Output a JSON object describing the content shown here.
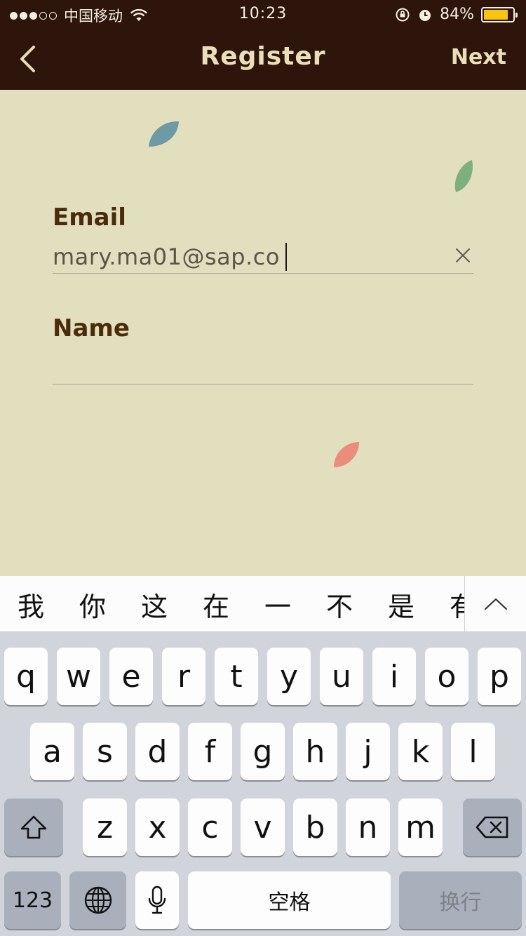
{
  "status_bar": {
    "carrier": "中国移动",
    "time": "10:23",
    "battery_percent": "84%",
    "battery_level": 0.84,
    "signal_bars_filled": 3,
    "signal_bars_total": 5
  },
  "nav": {
    "title": "Register",
    "next_label": "Next"
  },
  "form": {
    "email_label": "Email",
    "email_value": "mary.ma01@sap.co",
    "name_label": "Name",
    "name_value": ""
  },
  "leaf_colors": [
    "#6d9aa4",
    "#7fae7f",
    "#ec8c7c"
  ],
  "keyboard": {
    "candidates": [
      "我",
      "你",
      "这",
      "在",
      "一",
      "不",
      "是",
      "有"
    ],
    "row1": [
      "q",
      "w",
      "e",
      "r",
      "t",
      "y",
      "u",
      "i",
      "o",
      "p"
    ],
    "row2": [
      "a",
      "s",
      "d",
      "f",
      "g",
      "h",
      "j",
      "k",
      "l"
    ],
    "row3": [
      "z",
      "x",
      "c",
      "v",
      "b",
      "n",
      "m"
    ],
    "numbers_label": "123",
    "space_label": "空格",
    "return_label": "换行"
  },
  "icons": {
    "back": "chevron-left-icon",
    "clear": "close-icon",
    "expand": "chevron-up-icon",
    "shift": "shift-icon",
    "delete": "backspace-icon",
    "globe": "globe-icon",
    "mic": "microphone-icon"
  }
}
